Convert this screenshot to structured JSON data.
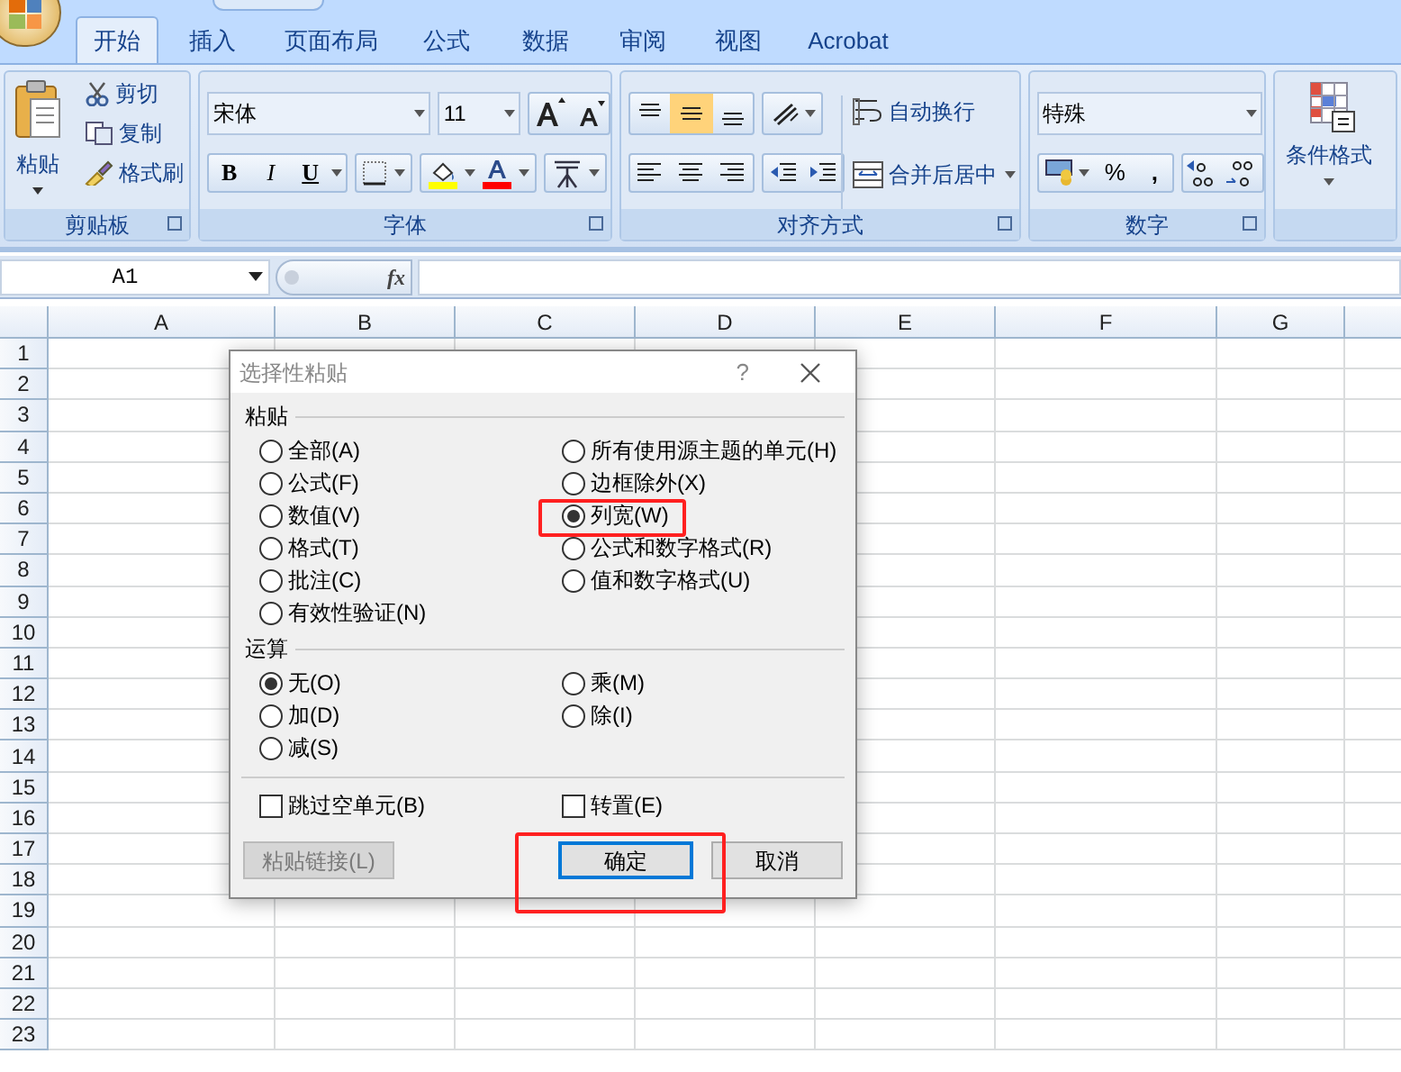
{
  "tabs": [
    {
      "label": "开始",
      "selected": true
    },
    {
      "label": "插入",
      "selected": false
    },
    {
      "label": "页面布局",
      "selected": false
    },
    {
      "label": "公式",
      "selected": false
    },
    {
      "label": "数据",
      "selected": false
    },
    {
      "label": "审阅",
      "selected": false
    },
    {
      "label": "视图",
      "selected": false
    },
    {
      "label": "Acrobat",
      "selected": false
    }
  ],
  "ribbon": {
    "clipboard": {
      "label": "剪贴板",
      "paste": "粘贴",
      "cut": "剪切",
      "copy": "复制",
      "format_painter": "格式刷"
    },
    "font": {
      "label": "字体",
      "font_name": "宋体",
      "font_size": "11",
      "bold": "B",
      "italic": "I",
      "underline": "U"
    },
    "alignment": {
      "label": "对齐方式",
      "wrap_text": "自动换行",
      "merge_center": "合并后居中"
    },
    "number": {
      "label": "数字",
      "format": "特殊",
      "percent": "%",
      "comma": ","
    },
    "styles": {
      "conditional_format": "条件格式"
    }
  },
  "formula_bar": {
    "name_box": "A1",
    "fx": "fx"
  },
  "sheet": {
    "columns": [
      "A",
      "B",
      "C",
      "D",
      "E",
      "F",
      "G"
    ],
    "rows": [
      "1",
      "2",
      "3",
      "4",
      "5",
      "6",
      "7",
      "8",
      "9",
      "10",
      "11",
      "12",
      "13",
      "14",
      "15",
      "16",
      "17",
      "18",
      "19",
      "20",
      "21",
      "22",
      "23"
    ]
  },
  "dialog": {
    "title": "选择性粘贴",
    "help": "?",
    "paste": {
      "label": "粘贴",
      "options": [
        {
          "label": "全部(A)",
          "selected": false
        },
        {
          "label": "公式(F)",
          "selected": false
        },
        {
          "label": "数值(V)",
          "selected": false
        },
        {
          "label": "格式(T)",
          "selected": false
        },
        {
          "label": "批注(C)",
          "selected": false
        },
        {
          "label": "有效性验证(N)",
          "selected": false
        },
        {
          "label": "所有使用源主题的单元(H)",
          "selected": false
        },
        {
          "label": "边框除外(X)",
          "selected": false
        },
        {
          "label": "列宽(W)",
          "selected": true
        },
        {
          "label": "公式和数字格式(R)",
          "selected": false
        },
        {
          "label": "值和数字格式(U)",
          "selected": false
        }
      ]
    },
    "operation": {
      "label": "运算",
      "options": [
        {
          "label": "无(O)",
          "selected": true
        },
        {
          "label": "加(D)",
          "selected": false
        },
        {
          "label": "减(S)",
          "selected": false
        },
        {
          "label": "乘(M)",
          "selected": false
        },
        {
          "label": "除(I)",
          "selected": false
        }
      ]
    },
    "checkboxes": [
      {
        "label": "跳过空单元(B)",
        "checked": false
      },
      {
        "label": "转置(E)",
        "checked": false
      }
    ],
    "buttons": [
      {
        "label": "粘贴链接(L)",
        "disabled": true,
        "default": false
      },
      {
        "label": "确定",
        "disabled": false,
        "default": true
      },
      {
        "label": "取消",
        "disabled": false,
        "default": false
      }
    ]
  }
}
